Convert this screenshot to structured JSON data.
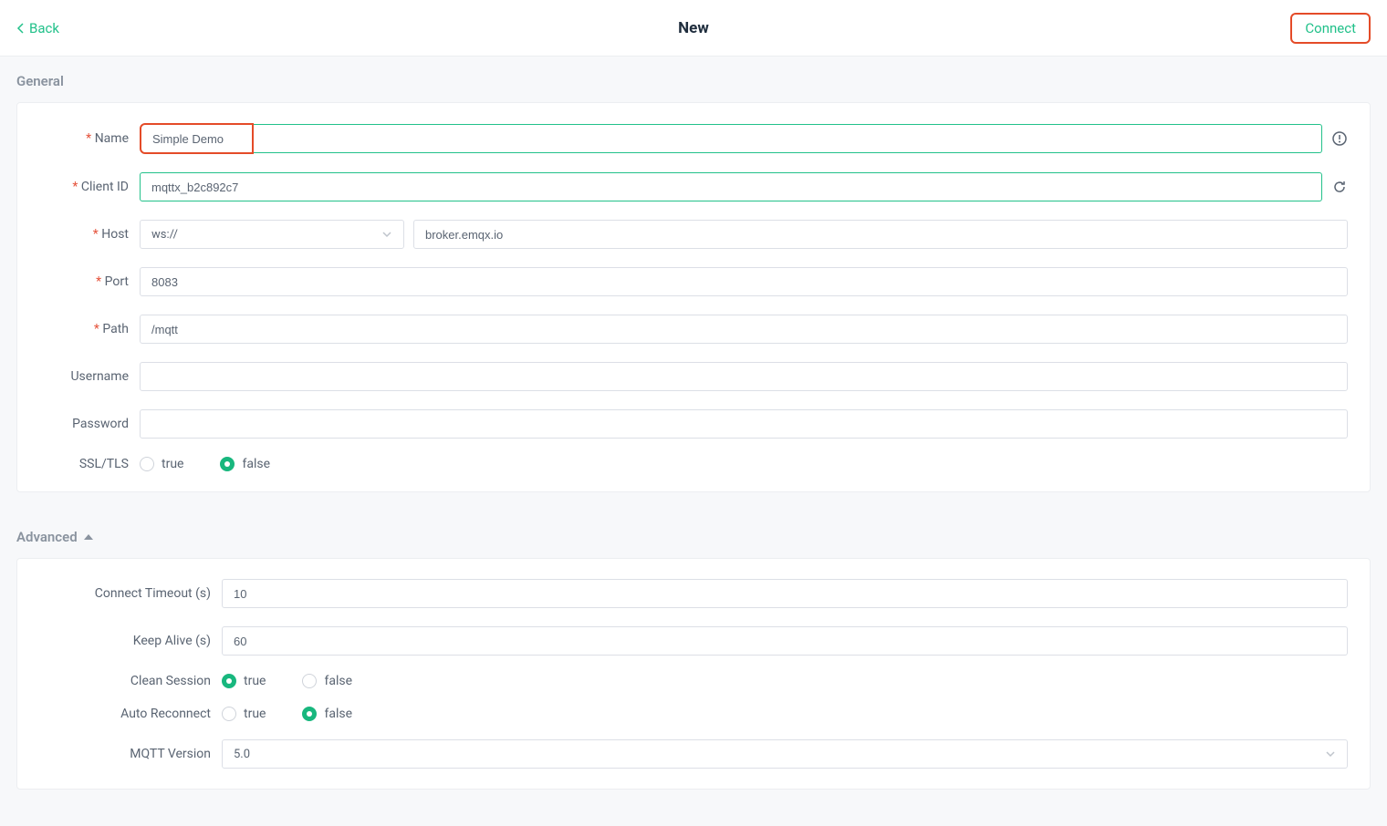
{
  "header": {
    "back_label": "Back",
    "title": "New",
    "connect_label": "Connect"
  },
  "sections": {
    "general": "General",
    "advanced": "Advanced"
  },
  "general": {
    "labels": {
      "name": "Name",
      "client_id": "Client ID",
      "host": "Host",
      "port": "Port",
      "path": "Path",
      "username": "Username",
      "password": "Password",
      "ssl": "SSL/TLS"
    },
    "values": {
      "name": "Simple Demo",
      "client_id": "mqttx_b2c892c7",
      "protocol": "ws://",
      "host": "broker.emqx.io",
      "port": "8083",
      "path": "/mqtt",
      "username": "",
      "password": ""
    },
    "ssl": {
      "selected": "false",
      "opt_true": "true",
      "opt_false": "false"
    }
  },
  "advanced": {
    "labels": {
      "connect_timeout": "Connect Timeout (s)",
      "keep_alive": "Keep Alive (s)",
      "clean_session": "Clean Session",
      "auto_reconnect": "Auto Reconnect",
      "mqtt_version": "MQTT Version"
    },
    "values": {
      "connect_timeout": "10",
      "keep_alive": "60",
      "mqtt_version": "5.0"
    },
    "clean_session": {
      "selected": "true",
      "opt_true": "true",
      "opt_false": "false"
    },
    "auto_reconnect": {
      "selected": "false",
      "opt_true": "true",
      "opt_false": "false"
    }
  }
}
